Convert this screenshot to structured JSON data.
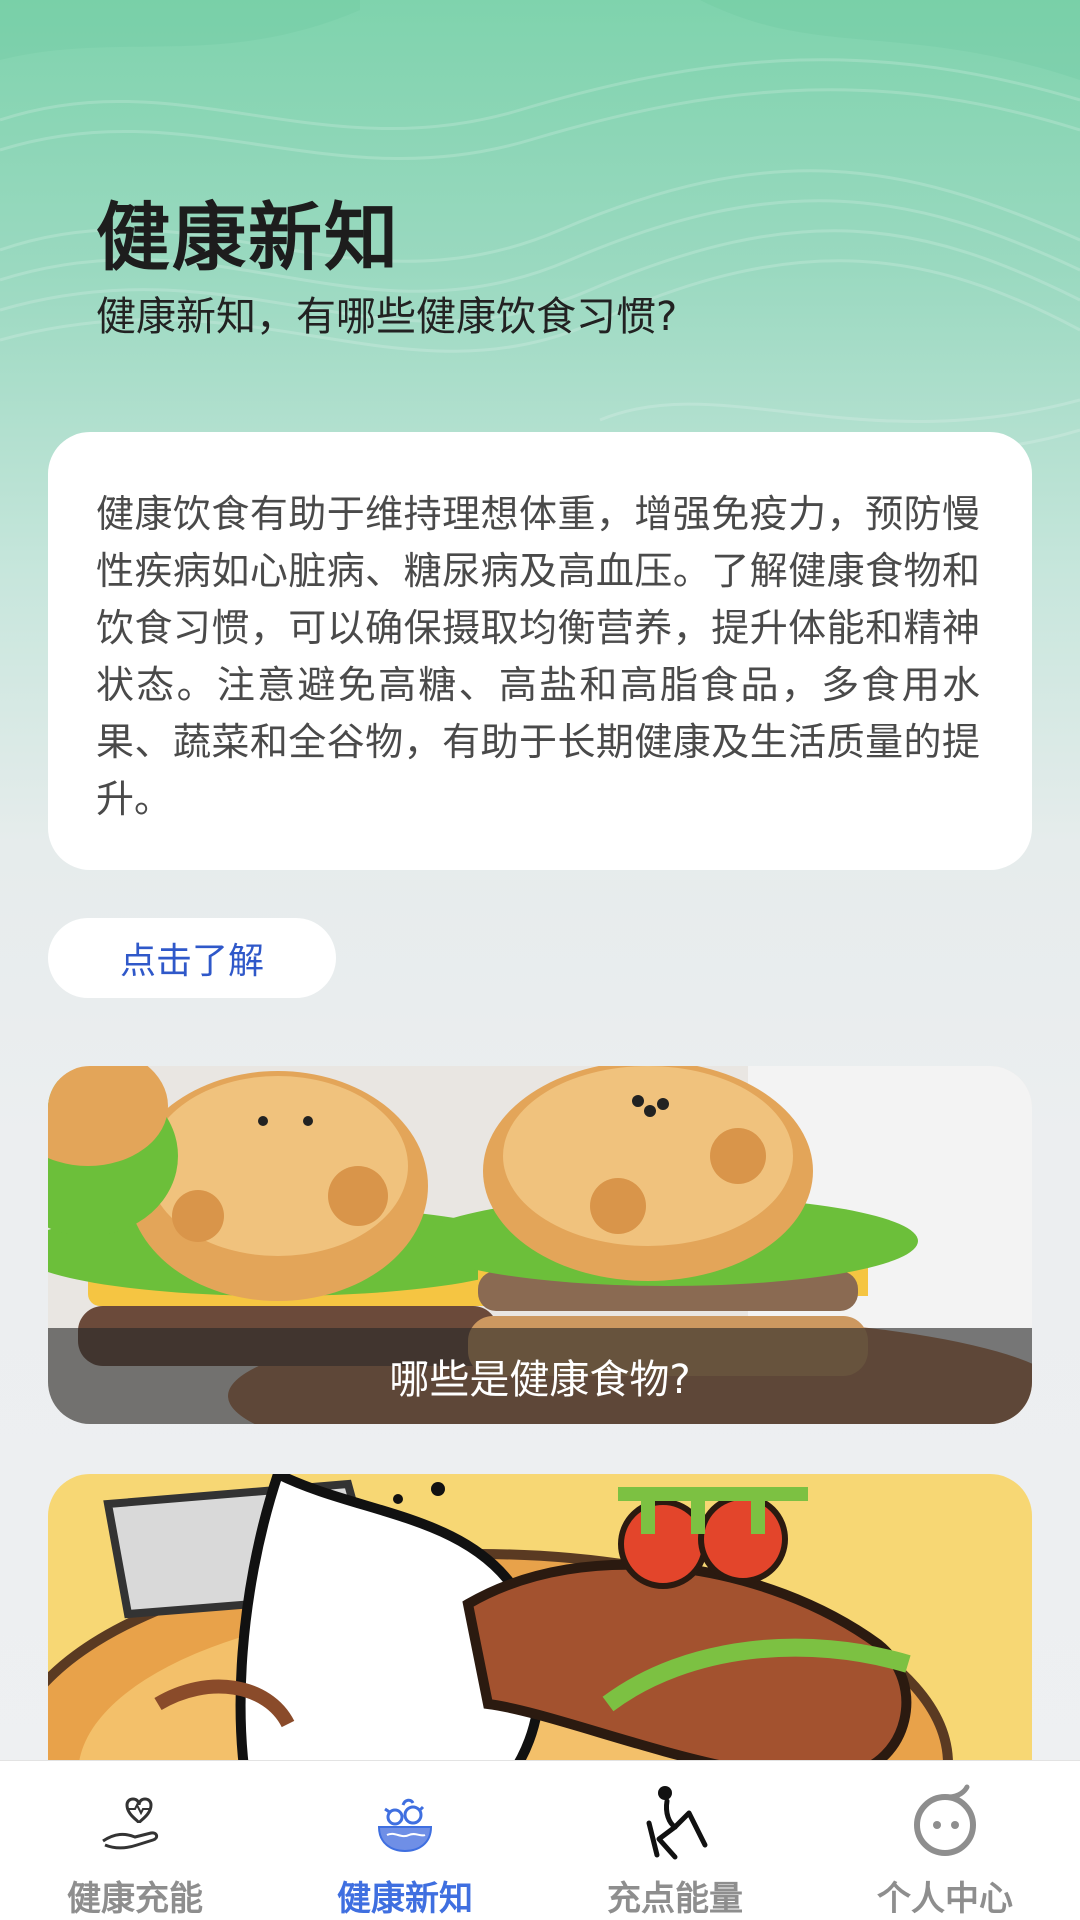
{
  "header": {
    "title": "健康新知",
    "subtitle": "健康新知，有哪些健康饮食习惯?"
  },
  "intro": {
    "text": "健康饮食有助于维持理想体重，增强免疫力，预防慢性疾病如心脏病、糖尿病及高血压。了解健康食物和饮食习惯，可以确保摄取均衡营养，提升体能和精神状态。注意避免高糖、高盐和高脂食品，多食用水果、蔬菜和全谷物，有助于长期健康及生活质量的提升。"
  },
  "learn_button": {
    "label": "点击了解"
  },
  "articles": [
    {
      "caption": "哪些是健康食物?",
      "image": "bear-burgers-image"
    },
    {
      "caption": "",
      "image": "cartoon-chef-dog-image"
    }
  ],
  "tabbar": {
    "items": [
      {
        "label": "健康充能",
        "icon": "hand-heart-icon",
        "active": false
      },
      {
        "label": "健康新知",
        "icon": "salad-bowl-icon",
        "active": true
      },
      {
        "label": "充点能量",
        "icon": "yoga-person-icon",
        "active": false
      },
      {
        "label": "个人中心",
        "icon": "face-avatar-icon",
        "active": false
      }
    ]
  },
  "colors": {
    "accent": "#3f6fe0",
    "button_text": "#2f58c9",
    "inactive_tab": "#8e8e8e"
  }
}
